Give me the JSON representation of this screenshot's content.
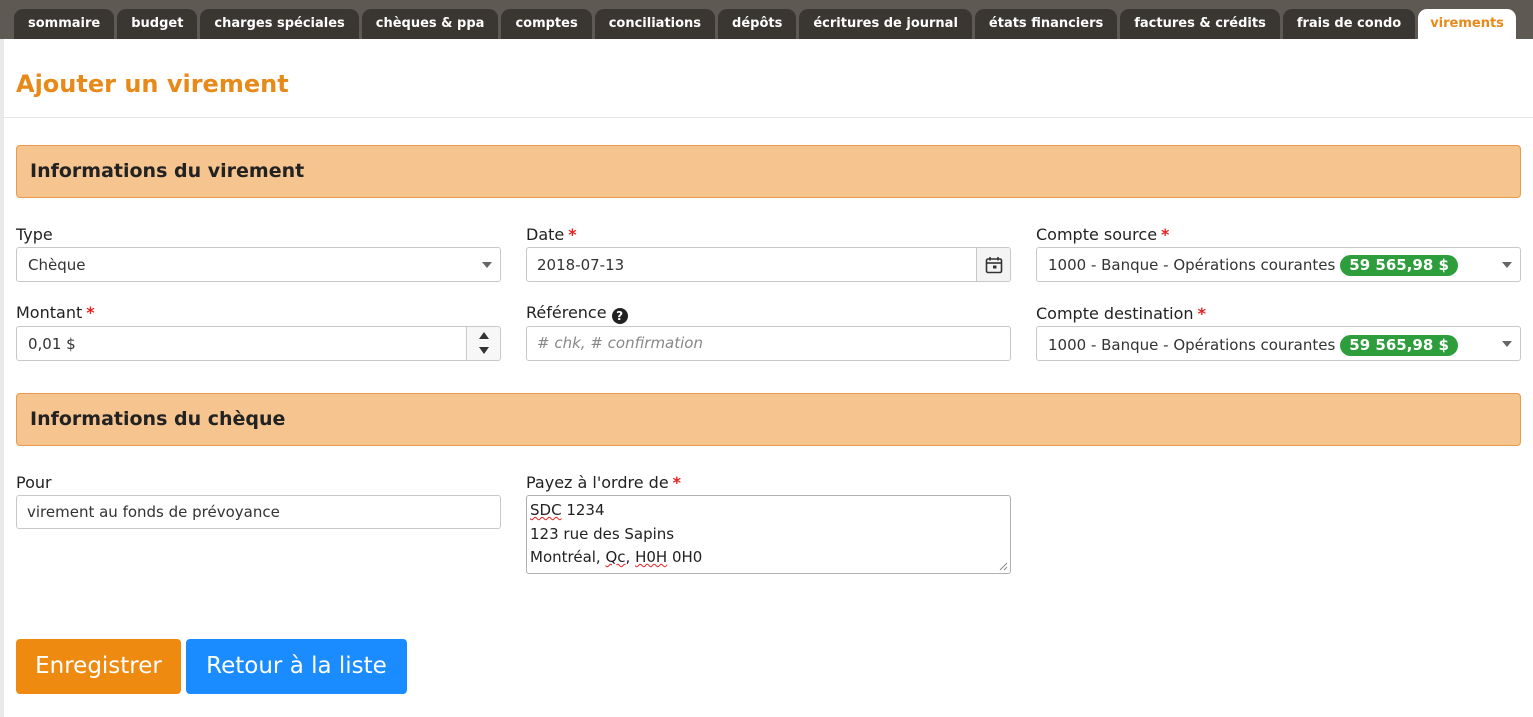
{
  "tabs": [
    {
      "label": "sommaire",
      "active": false
    },
    {
      "label": "budget",
      "active": false
    },
    {
      "label": "charges spéciales",
      "active": false
    },
    {
      "label": "chèques & ppa",
      "active": false
    },
    {
      "label": "comptes",
      "active": false
    },
    {
      "label": "conciliations",
      "active": false
    },
    {
      "label": "dépôts",
      "active": false
    },
    {
      "label": "écritures de journal",
      "active": false
    },
    {
      "label": "états financiers",
      "active": false
    },
    {
      "label": "factures & crédits",
      "active": false
    },
    {
      "label": "frais de condo",
      "active": false
    },
    {
      "label": "virements",
      "active": true
    }
  ],
  "page": {
    "title": "Ajouter un virement"
  },
  "required_mark": "*",
  "transfer_section": {
    "title": "Informations du virement",
    "type": {
      "label": "Type",
      "value": "Chèque"
    },
    "date": {
      "label": "Date",
      "value": "2018-07-13",
      "icon": "calendar-icon"
    },
    "source_account": {
      "label": "Compte source",
      "value": "1000 - Banque - Opérations courantes",
      "balance": "59 565,98 $"
    },
    "amount": {
      "label": "Montant",
      "value": "0,01 $"
    },
    "reference": {
      "label": "Référence",
      "placeholder": "# chk, # confirmation",
      "help_icon": "?"
    },
    "destination_account": {
      "label": "Compte destination",
      "value": "1000 - Banque - Opérations courantes",
      "balance": "59 565,98 $"
    }
  },
  "cheque_section": {
    "title": "Informations du chèque",
    "pour": {
      "label": "Pour",
      "value": "virement au fonds de prévoyance"
    },
    "payee": {
      "label": "Payez à l'ordre de",
      "line1_a": "SDC",
      "line1_b": " 1234",
      "line2": "123 rue des Sapins",
      "line3_a": "Montréal, ",
      "line3_b": "Qc",
      "line3_c": ", ",
      "line3_d": "H0H",
      "line3_e": " 0H0"
    }
  },
  "actions": {
    "save": "Enregistrer",
    "back": "Retour à la liste"
  },
  "colors": {
    "accent": "#e88a1a",
    "section_bg": "#f5c48f",
    "badge": "#2e9e3d",
    "save": "#ee8a10",
    "back": "#1a8cff"
  }
}
